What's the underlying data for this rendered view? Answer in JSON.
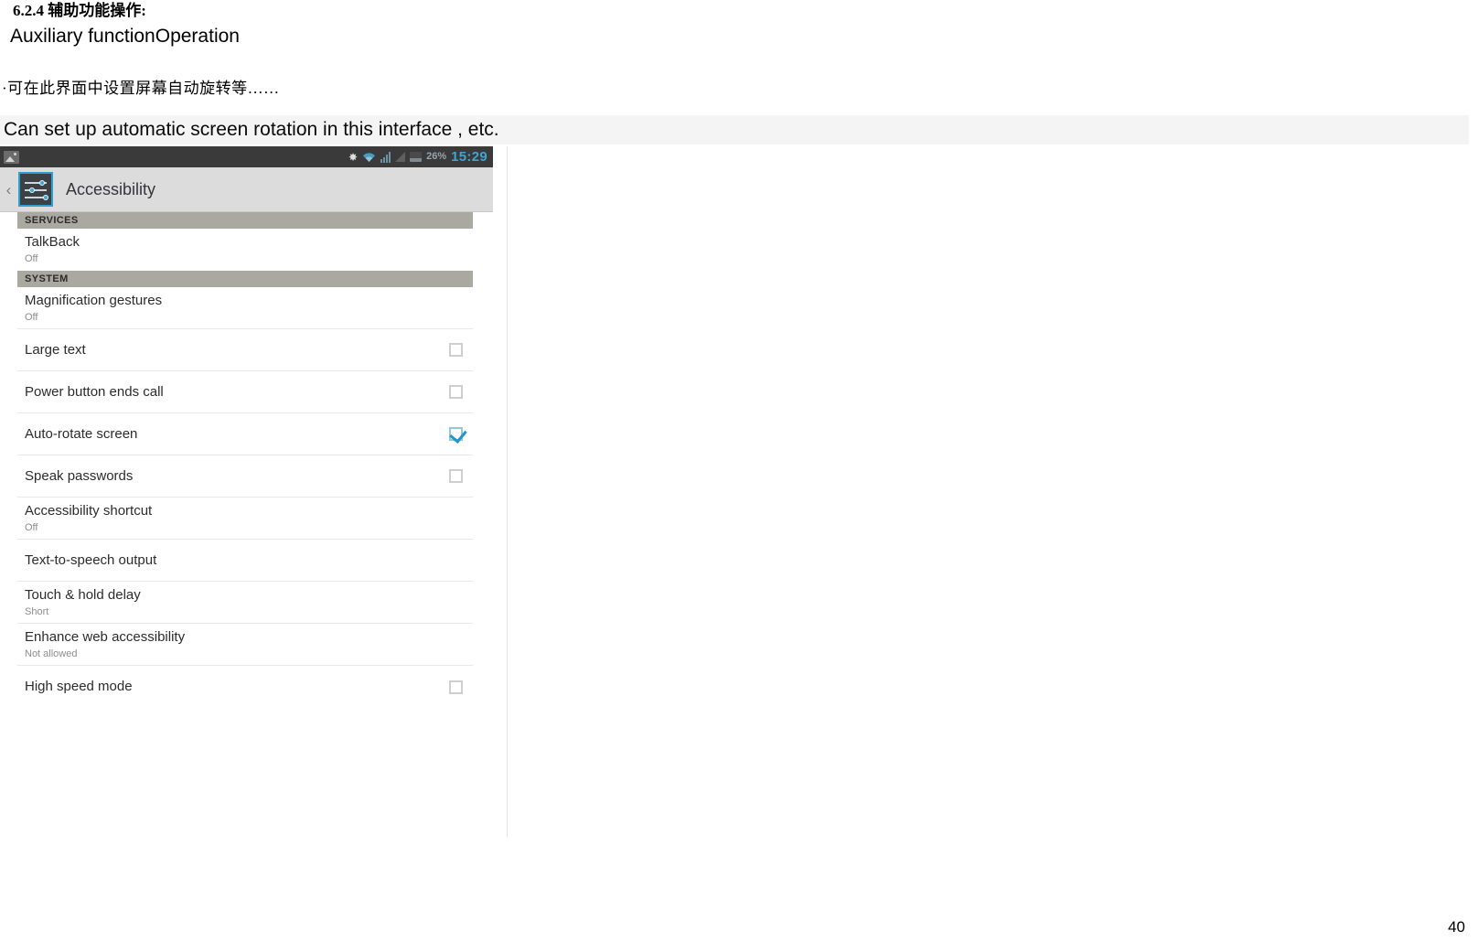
{
  "document": {
    "heading_cn": "6.2.4 辅助功能操作:",
    "heading_en": "Auxiliary functionOperation",
    "bullet_cn": "·可在此界面中设置屏幕自动旋转等……",
    "caption_en": "Can set up automatic screen rotation in this interface , etc.",
    "page_number": "40"
  },
  "phone": {
    "status_bar": {
      "battery_percent": "26%",
      "time": "15:29",
      "icons": [
        "screenshot-icon",
        "bluetooth-icon",
        "wifi-icon",
        "signal-icon",
        "triangle-icon",
        "battery-icon"
      ]
    },
    "action_bar": {
      "back_glyph": "‹",
      "icon": "accessibility-sliders-icon",
      "title": "Accessibility"
    },
    "sections": [
      {
        "header": "SERVICES",
        "rows": [
          {
            "title": "TalkBack",
            "subtitle": "Off",
            "control": "none",
            "checked": false
          }
        ]
      },
      {
        "header": "SYSTEM",
        "rows": [
          {
            "title": "Magnification gestures",
            "subtitle": "Off",
            "control": "none",
            "checked": false
          },
          {
            "title": "Large text",
            "subtitle": "",
            "control": "checkbox",
            "checked": false
          },
          {
            "title": "Power button ends call",
            "subtitle": "",
            "control": "checkbox",
            "checked": false
          },
          {
            "title": "Auto-rotate screen",
            "subtitle": "",
            "control": "checkbox",
            "checked": true
          },
          {
            "title": "Speak passwords",
            "subtitle": "",
            "control": "checkbox",
            "checked": false
          },
          {
            "title": "Accessibility shortcut",
            "subtitle": "Off",
            "control": "none",
            "checked": false
          },
          {
            "title": "Text-to-speech output",
            "subtitle": "",
            "control": "none",
            "checked": false
          },
          {
            "title": "Touch & hold delay",
            "subtitle": "Short",
            "control": "none",
            "checked": false
          },
          {
            "title": "Enhance web accessibility",
            "subtitle": "Not allowed",
            "control": "none",
            "checked": false
          },
          {
            "title": "High speed mode",
            "subtitle": "",
            "control": "checkbox",
            "checked": false
          }
        ]
      }
    ]
  },
  "colors": {
    "accent_blue": "#2196c9",
    "time_blue": "#3ba5d4",
    "status_bar_bg": "#3a3a3a",
    "action_bar_bg": "#dcdcdc",
    "section_header_bg": "#a9a9a1",
    "caption_band_bg": "#f4f4f4"
  }
}
